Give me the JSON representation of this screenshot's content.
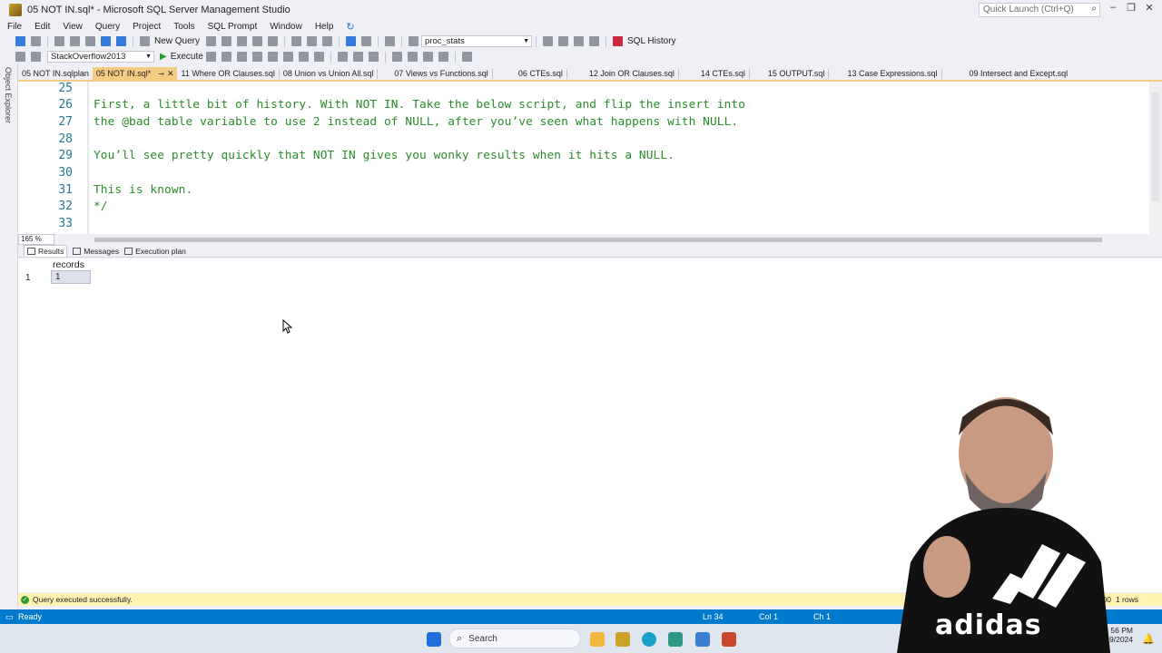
{
  "window": {
    "title": "05 NOT IN.sql* - Microsoft SQL Server Management Studio",
    "quick_launch_placeholder": "Quick Launch (Ctrl+Q)"
  },
  "menu": [
    "File",
    "Edit",
    "View",
    "Query",
    "Project",
    "Tools",
    "SQL Prompt",
    "Window",
    "Help"
  ],
  "toolbar": {
    "new_query_label": "New Query",
    "proc_combo_value": "proc_stats",
    "sql_history_label": "SQL History",
    "database_combo_value": "StackOverflow2013",
    "execute_label": "Execute"
  },
  "sidebar": {
    "object_explorer_label": "Object Explorer"
  },
  "tabs": [
    {
      "label": "05 NOT IN.sqlplan",
      "active": false
    },
    {
      "label": "05 NOT IN.sql*",
      "active": true
    },
    {
      "label": "11 Where OR Clauses.sql",
      "active": false
    },
    {
      "label": "08 Union vs Union All.sql",
      "active": false
    },
    {
      "label": "07 Views vs Functions.sql",
      "active": false
    },
    {
      "label": "06 CTEs.sql",
      "active": false
    },
    {
      "label": "12 Join OR Clauses.sql",
      "active": false
    },
    {
      "label": "14 CTEs.sql",
      "active": false
    },
    {
      "label": "15 OUTPUT.sql",
      "active": false
    },
    {
      "label": "13 Case Expressions.sql",
      "active": false
    },
    {
      "label": "09 Intersect and Except.sql",
      "active": false
    }
  ],
  "editor": {
    "zoom": "165 %",
    "lines": [
      {
        "no": "25",
        "text": ""
      },
      {
        "no": "26",
        "text": "First, a little bit of history. With NOT IN. Take the below script, and flip the insert into"
      },
      {
        "no": "27",
        "text": "the @bad table variable to use 2 instead of NULL, after you’ve seen what happens with NULL."
      },
      {
        "no": "28",
        "text": ""
      },
      {
        "no": "29",
        "text": "You’ll see pretty quickly that NOT IN gives you wonky results when it hits a NULL."
      },
      {
        "no": "30",
        "text": ""
      },
      {
        "no": "31",
        "text": "This is known."
      },
      {
        "no": "32",
        "text": "*/"
      },
      {
        "no": "33",
        "text": ""
      }
    ]
  },
  "results_tabs": [
    "Results",
    "Messages",
    "Execution plan"
  ],
  "results": {
    "columns": [
      "records"
    ],
    "rows": [
      {
        "row_no": "1",
        "values": [
          "1"
        ]
      }
    ]
  },
  "query_status": {
    "message": "Query executed successfully.",
    "time": "00",
    "rows": "1 rows"
  },
  "status_bar": {
    "state": "Ready",
    "ln": "Ln 34",
    "col": "Col 1",
    "ch": "Ch 1"
  },
  "taskbar": {
    "search_label": "Search",
    "clock_time": "56 PM",
    "clock_date": "9/2024"
  },
  "colors": {
    "active_tab": "#f5cc84",
    "status_bar": "#007acc",
    "comment_text": "#2b8a2b",
    "line_numbers": "#237893"
  }
}
